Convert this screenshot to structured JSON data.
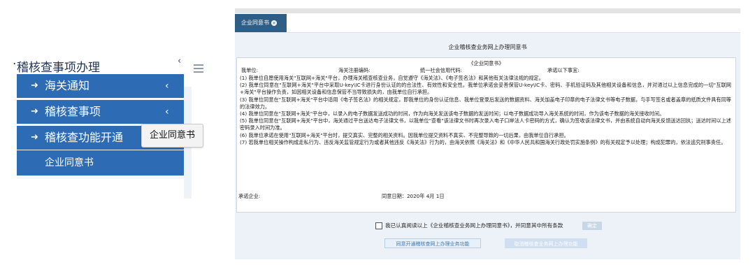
{
  "sidebar": {
    "section_title": "稽核查事项办理",
    "title_lead": "·",
    "collapse_glyph": "‹",
    "items": [
      {
        "label": "海关通知",
        "arrow": "➜",
        "chevron": "‹"
      },
      {
        "label": "稽核查事项",
        "arrow": "➜",
        "chevron": "‹"
      },
      {
        "label": "稽核查功能开通",
        "arrow": "➜",
        "chevron": ""
      },
      {
        "label": "企业同意书"
      }
    ],
    "tooltip": "企业同意书"
  },
  "tabs": [
    {
      "label": "企业同意书",
      "close_glyph": "×"
    }
  ],
  "page_title": "企业稽核查业务网上办理同意书",
  "doc": {
    "heading": "《企业同意书》",
    "fields": {
      "company": "我单位:",
      "customs_code": "海关注册编码:",
      "credit_code": "统一社会信用代码:",
      "commitment": "承诺以下事宜:"
    },
    "items": [
      "(1) 我单位自愿使用海关\"互联网+海关\"平台，办理海关稽查核查业务，自觉遵守《海关法》、《电子签名法》和其他有关法律法规的规定。",
      "(2) 我单位同意在\"互联网+海关\"平台中采取U-key\\IC卡进行身份认证的的合法性、有效性和安全性。我单位承诺会妥善保管U-key\\IC卡、密码、手机验证码及其他相关设备和信息，并对通过以上信息完成的一切\"互联网+海关\"平台操作负责，如因相关设备和信息保管不当导致损失的，由我单位自行承担。",
      "(3) 我单位同意在\"互联网+海关\"平台中适用《电子签名法》的相关规定，即我单位的身份认证信息、我单位登录后发送的数据资料、海关加盖电子印章的电子法律文书等电子数据，与手写签名或者盖章的纸质文件具有同等的法律效力。",
      "(4) 我单位同意在\"互联网+海关\"平台中，以录入的电子数据发送成功的时间，作为向海关发送该电子数据的发送时间；以电子数据成功导入海关系统的时间，作为该电子数据的海关接收时间。",
      "(5) 我单位同意在\"互联网+海关\"平台中，海关通过平台送达电子法律文书，以我单位\"查看\"该法律文书时再次录入电子口岸法人卡密码的方式，确认为签收该法律文书，并由系统自动向海关反馈送达回执；送达时间以上述密码录入时间为准。",
      "(6) 我单位承诺在使用\"互联网+海关\"平台时，提交真实、完整的相关资料。因我单位提交资料不真实、不完整导致的一切后果，由我单位自行承担。",
      "(7) 若我单位相关操作构成走私行为、违反海关监管规定行为或者其他违反《海关法》行为的，由海关依照《海关法》和《中华人民共和国海关行政处罚实施条例》的有关规定予以处理；构成犯罪的，依法追究刑事责任。"
    ],
    "sign_company": "承诺企业:",
    "agree_date": "同意日期：2020年   4月   1日"
  },
  "agree": {
    "checkbox_label": "我已认真阅读以上《企业稽核查业务网上办理同意书》，并同意其中所有条款",
    "confirm_label": "确定"
  },
  "buttons": {
    "enable": "同意开通稽核查网上办理业务功能",
    "cancel": "取消稽核查业务网上办理功能"
  },
  "colors": {
    "menu_blue": "#2d6bb5",
    "tab_navy": "#2e5d86",
    "panel_bg": "#ecf2f8",
    "link_blue": "#3c78b8"
  }
}
